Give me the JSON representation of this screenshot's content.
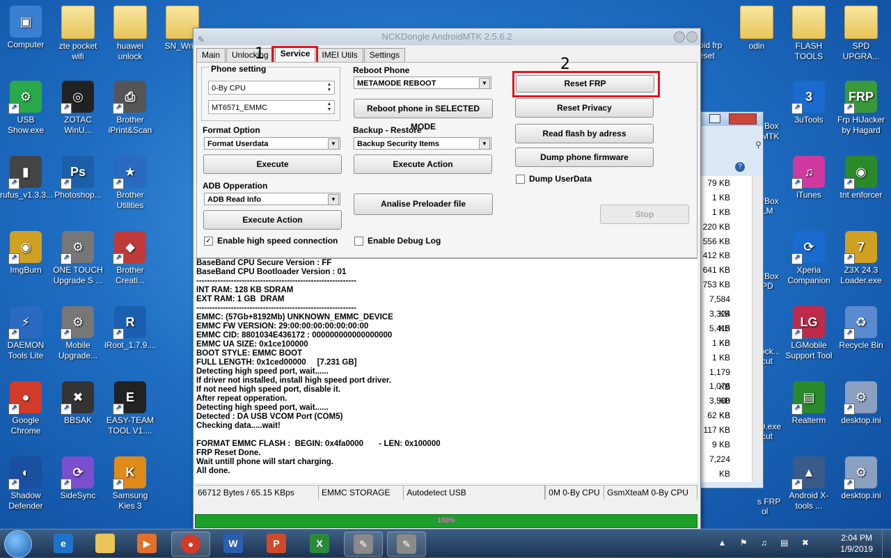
{
  "desktop_icons": [
    {
      "label": "Computer",
      "x": 0,
      "y": 0,
      "color": "#3a7fd0",
      "glyph": "▣",
      "folder": false
    },
    {
      "label": "zte pocket wifi",
      "folder": true
    },
    {
      "label": "huawei unlock",
      "folder": true
    },
    {
      "label": "SN_Write",
      "folder": true
    },
    {
      "label": "USB Show.exe",
      "glyph": "⚙",
      "color": "#2aa84a"
    },
    {
      "label": "ZOTAC WinU...",
      "glyph": "◎",
      "color": "#222"
    },
    {
      "label": "Brother iPrint&Scan",
      "glyph": "⎙",
      "color": "#555"
    },
    {
      "label": "rufus_v1.3.3...",
      "glyph": "▮",
      "color": "#444"
    },
    {
      "label": "Photoshop...",
      "glyph": "Ps",
      "color": "#1b5fa8"
    },
    {
      "label": "Brother Utilities",
      "glyph": "★",
      "color": "#2a6ac0"
    },
    {
      "label": "ImgBurn",
      "glyph": "◉",
      "color": "#d0a020"
    },
    {
      "label": "ONE TOUCH Upgrade S ...",
      "glyph": "⚙",
      "color": "#777"
    },
    {
      "label": "Brother Creati...",
      "glyph": "◆",
      "color": "#c03a3a"
    },
    {
      "label": "DAEMON Tools Lite",
      "glyph": "⚡",
      "color": "#2a6ac0"
    },
    {
      "label": "Mobile Upgrade...",
      "glyph": "⚙",
      "color": "#777"
    },
    {
      "label": "iRoot_1.7.9....",
      "glyph": "R",
      "color": "#1a5fb0"
    },
    {
      "label": "Google Chrome",
      "glyph": "●",
      "color": "#d23a2a"
    },
    {
      "label": "BBSAK",
      "glyph": "✖",
      "color": "#333"
    },
    {
      "label": "EASY-TEAM TOOL V1....",
      "glyph": "E",
      "color": "#222"
    },
    {
      "label": "Shadow Defender",
      "glyph": "◐",
      "color": "#1a4fa0"
    },
    {
      "label": "SideSync",
      "glyph": "⟳",
      "color": "#7a4fd0"
    },
    {
      "label": "Samsung Kies 3",
      "glyph": "K",
      "color": "#e08a1a"
    }
  ],
  "right_icons": [
    {
      "label": "odin",
      "folder": true
    },
    {
      "label": "FLASH TOOLS",
      "folder": true
    },
    {
      "label": "SPD UPGRA...",
      "folder": true
    },
    {
      "label": "3uTools",
      "glyph": "3",
      "color": "#1a6ad0"
    },
    {
      "label": "Frp HiJacker by Hagard",
      "glyph": "FRP",
      "color": "#3a9a3a"
    },
    {
      "label": "iTunes",
      "glyph": "♫",
      "color": "#d03aa0"
    },
    {
      "label": "tnt enforcer",
      "glyph": "◉",
      "color": "#2a8a2a"
    },
    {
      "label": "Xperia Companion",
      "glyph": "⟳",
      "color": "#1a6ad0"
    },
    {
      "label": "Z3X 24.3 Loader.exe",
      "glyph": "7",
      "color": "#d0a020"
    },
    {
      "label": "LGMobile Support Tool",
      "glyph": "LG",
      "color": "#c02a4a"
    },
    {
      "label": "Recycle Bin",
      "glyph": "♻",
      "color": "#5a8ad0"
    },
    {
      "label": "Realterm",
      "glyph": "▤",
      "color": "#2a8a2a"
    },
    {
      "label": "desktop.ini",
      "glyph": "⚙",
      "color": "#8aa0c0"
    },
    {
      "label": "Android X-tools ...",
      "glyph": "▲",
      "color": "#3a5a8a"
    },
    {
      "label": "desktop.ini",
      "glyph": "⚙",
      "color": "#8aa0c0"
    }
  ],
  "partial_labels": [
    "roid frp",
    "eset",
    "rBox",
    "MTK",
    "rBox",
    "LM",
    "rBox",
    "PD",
    "ock...",
    "cut",
    "60.exe",
    "cut",
    "s FRP",
    "ol"
  ],
  "explorer_sizes": [
    "79 KB",
    "1 KB",
    "1 KB",
    "220 KB",
    "556 KB",
    "412 KB",
    "641 KB",
    "753 KB",
    "7,584 KB",
    "3,324 KB",
    "5,415 KB",
    "1 KB",
    "1 KB",
    "1,179 KB",
    "1,076 KB",
    "3,580 KB",
    "62 KB",
    "117 KB",
    "9 KB",
    "7,224 KB"
  ],
  "window": {
    "title": "NCKDongle AndroidMTK 2.5.6.2",
    "tabs": [
      "Main",
      "Unlocking",
      "Service",
      "IMEI Utils",
      "Settings"
    ],
    "active_tab": "Service",
    "marker_1": "1",
    "marker_2": "2",
    "phone_setting": {
      "label": "Phone setting",
      "cpu": "0-By CPU",
      "chip": "MT6571_EMMC"
    },
    "format": {
      "label": "Format Option",
      "value": "Format Userdata",
      "execute": "Execute"
    },
    "adb": {
      "label": "ADB Opperation",
      "value": "ADB Read Info",
      "execute": "Execute Action"
    },
    "reboot": {
      "label": "Reboot Phone",
      "value": "METAMODE REBOOT",
      "button": "Reboot phone in SELECTED MODE"
    },
    "backup": {
      "label": "Backup - Restore",
      "value": "Backup Security Items",
      "execute": "Execute Action"
    },
    "analise": "Analise Preloader file",
    "right_buttons": [
      "Reset FRP",
      "Reset Privacy",
      "Read flash by adress",
      "Dump phone firmware"
    ],
    "dump_userdata": "Dump UserData",
    "stop": "Stop",
    "high_speed": "Enable high speed connection",
    "debug_log": "Enable Debug Log",
    "log": [
      "BaseBand CPU Secure Version : FF",
      "BaseBand CPU Bootloader Version : 01",
      "------------------------------------------------------------",
      "INT RAM: 128 KB SDRAM",
      "EXT RAM: 1 GB  DRAM",
      "------------------------------------------------------------",
      "EMMC: (57Gb+8192Mb) UNKNOWN_EMMC_DEVICE",
      "EMMC FW VERSION: 29:00:00:00:00:00:00:00",
      "EMMC CID: 8801034E436172 : 000000000000000000",
      "EMMC UA SIZE: 0x1ce100000",
      "BOOT STYLE: EMMC BOOT",
      "FULL LENGTH: 0x1ced00000     [7.231 GB]",
      "Detecting high speed port, wait......",
      "If driver not installed, install high speed port driver.",
      "If not need high speed port, disable it.",
      "After repeat opperation.",
      "Detecting high speed port, wait......",
      "Detected : DA USB VCOM Port (COM5)",
      "Checking data.....wait!",
      "",
      "FORMAT EMMC FLASH :  BEGIN: 0x4fa0000       - LEN: 0x100000",
      "FRP Reset Done.",
      "Wait untill phone will start charging.",
      "All done."
    ],
    "status": [
      "66712 Bytes / 65.15 KBps",
      "EMMC STORAGE",
      "Autodetect USB",
      "",
      "0M 0-By CPU",
      "GsmXteaM 0-By CPU"
    ],
    "progress": "100%"
  },
  "taskbar": {
    "time": "2:04 PM",
    "date": "1/9/2019",
    "word_glyph": "W",
    "ppt_glyph": "P",
    "excel_glyph": "X"
  }
}
